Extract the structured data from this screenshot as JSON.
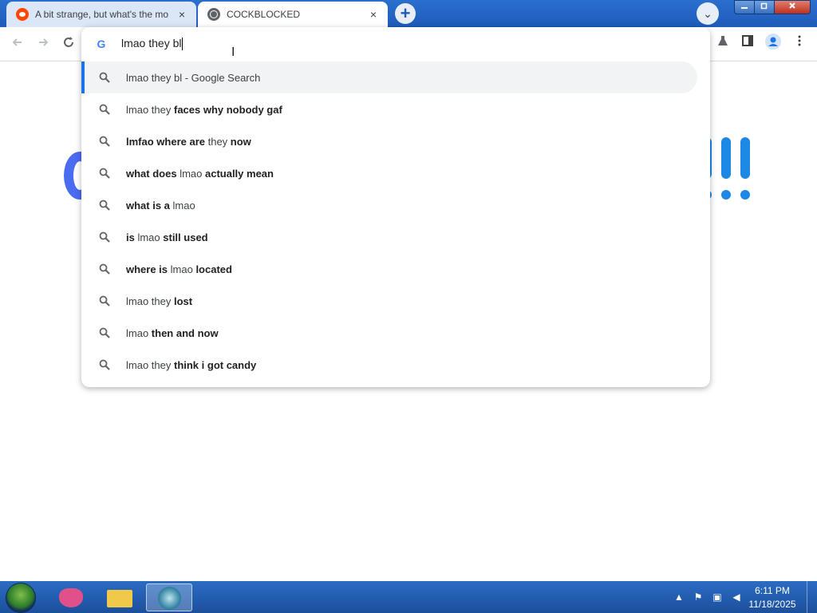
{
  "browser": {
    "tabs": [
      {
        "title": "A bit strange, but what's the mo",
        "favicon": "reddit-icon",
        "active": false
      },
      {
        "title": "COCKBLOCKED",
        "favicon": "globe-icon",
        "active": true
      }
    ],
    "close_glyph": "×",
    "new_tab_glyph": "+",
    "tab_search_glyph": "⌄"
  },
  "omnibox": {
    "query": "lmao they bl",
    "suggestions": [
      {
        "parts": [
          {
            "t": "lmao they bl - Google Search",
            "b": false
          }
        ],
        "selected": true
      },
      {
        "parts": [
          {
            "t": "lmao they ",
            "b": false
          },
          {
            "t": "faces why nobody gaf",
            "b": true
          }
        ]
      },
      {
        "parts": [
          {
            "t": "lmfao where are ",
            "b": true
          },
          {
            "t": "they ",
            "b": false
          },
          {
            "t": "now",
            "b": true
          }
        ]
      },
      {
        "parts": [
          {
            "t": "what does ",
            "b": true
          },
          {
            "t": "lmao ",
            "b": false
          },
          {
            "t": "actually mean",
            "b": true
          }
        ]
      },
      {
        "parts": [
          {
            "t": "what is a ",
            "b": true
          },
          {
            "t": "lmao",
            "b": false
          }
        ]
      },
      {
        "parts": [
          {
            "t": "is ",
            "b": true
          },
          {
            "t": "lmao ",
            "b": false
          },
          {
            "t": "still used",
            "b": true
          }
        ]
      },
      {
        "parts": [
          {
            "t": "where is ",
            "b": true
          },
          {
            "t": "lmao ",
            "b": false
          },
          {
            "t": "located",
            "b": true
          }
        ]
      },
      {
        "parts": [
          {
            "t": "lmao they ",
            "b": false
          },
          {
            "t": "lost",
            "b": true
          }
        ]
      },
      {
        "parts": [
          {
            "t": "lmao ",
            "b": false
          },
          {
            "t": "then and now",
            "b": true
          }
        ]
      },
      {
        "parts": [
          {
            "t": "lmao they ",
            "b": false
          },
          {
            "t": "think i got candy",
            "b": true
          }
        ]
      }
    ]
  },
  "taskbar": {
    "time": "6:11 PM",
    "date": "11/18/2025"
  },
  "colors": {
    "accent": "#1a73e8",
    "logo_blue": "#1e88e5",
    "logo_violet": "#4a6cf0"
  }
}
